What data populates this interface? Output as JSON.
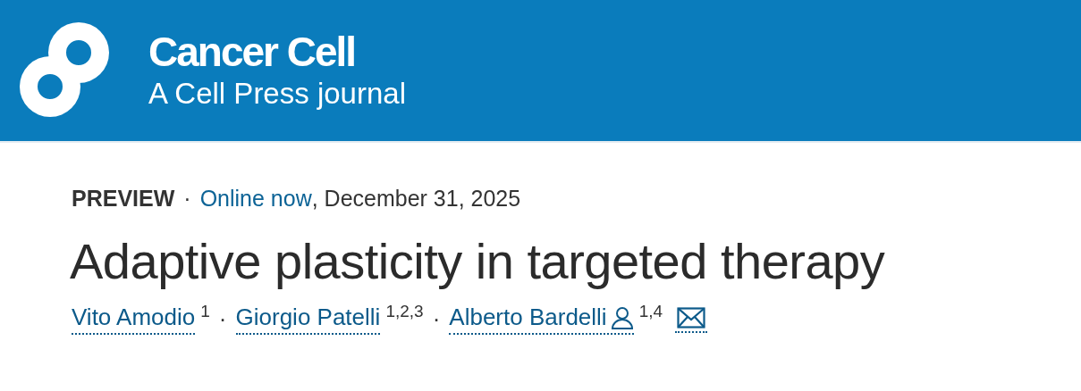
{
  "header": {
    "journal": "Cancer Cell",
    "tagline": "A Cell Press journal"
  },
  "meta": [
    {
      "kind": "label",
      "text": "PREVIEW"
    },
    {
      "kind": "separator",
      "text": "·"
    },
    {
      "kind": "link",
      "text": "Online now"
    },
    {
      "kind": "text",
      "text": ", December 31, 2025"
    }
  ],
  "title": "Adaptive plasticity in targeted therapy",
  "authors": [
    {
      "kind": "author",
      "name": "Vito Amodio",
      "affiliations": "1",
      "corresponding": false
    },
    {
      "kind": "separator",
      "text": "·"
    },
    {
      "kind": "author",
      "name": "Giorgio Patelli",
      "affiliations": "1,2,3",
      "corresponding": false
    },
    {
      "kind": "separator",
      "text": "·"
    },
    {
      "kind": "author",
      "name": "Alberto Bardelli",
      "affiliations": "1,4",
      "corresponding": true
    }
  ],
  "email_link": true
}
